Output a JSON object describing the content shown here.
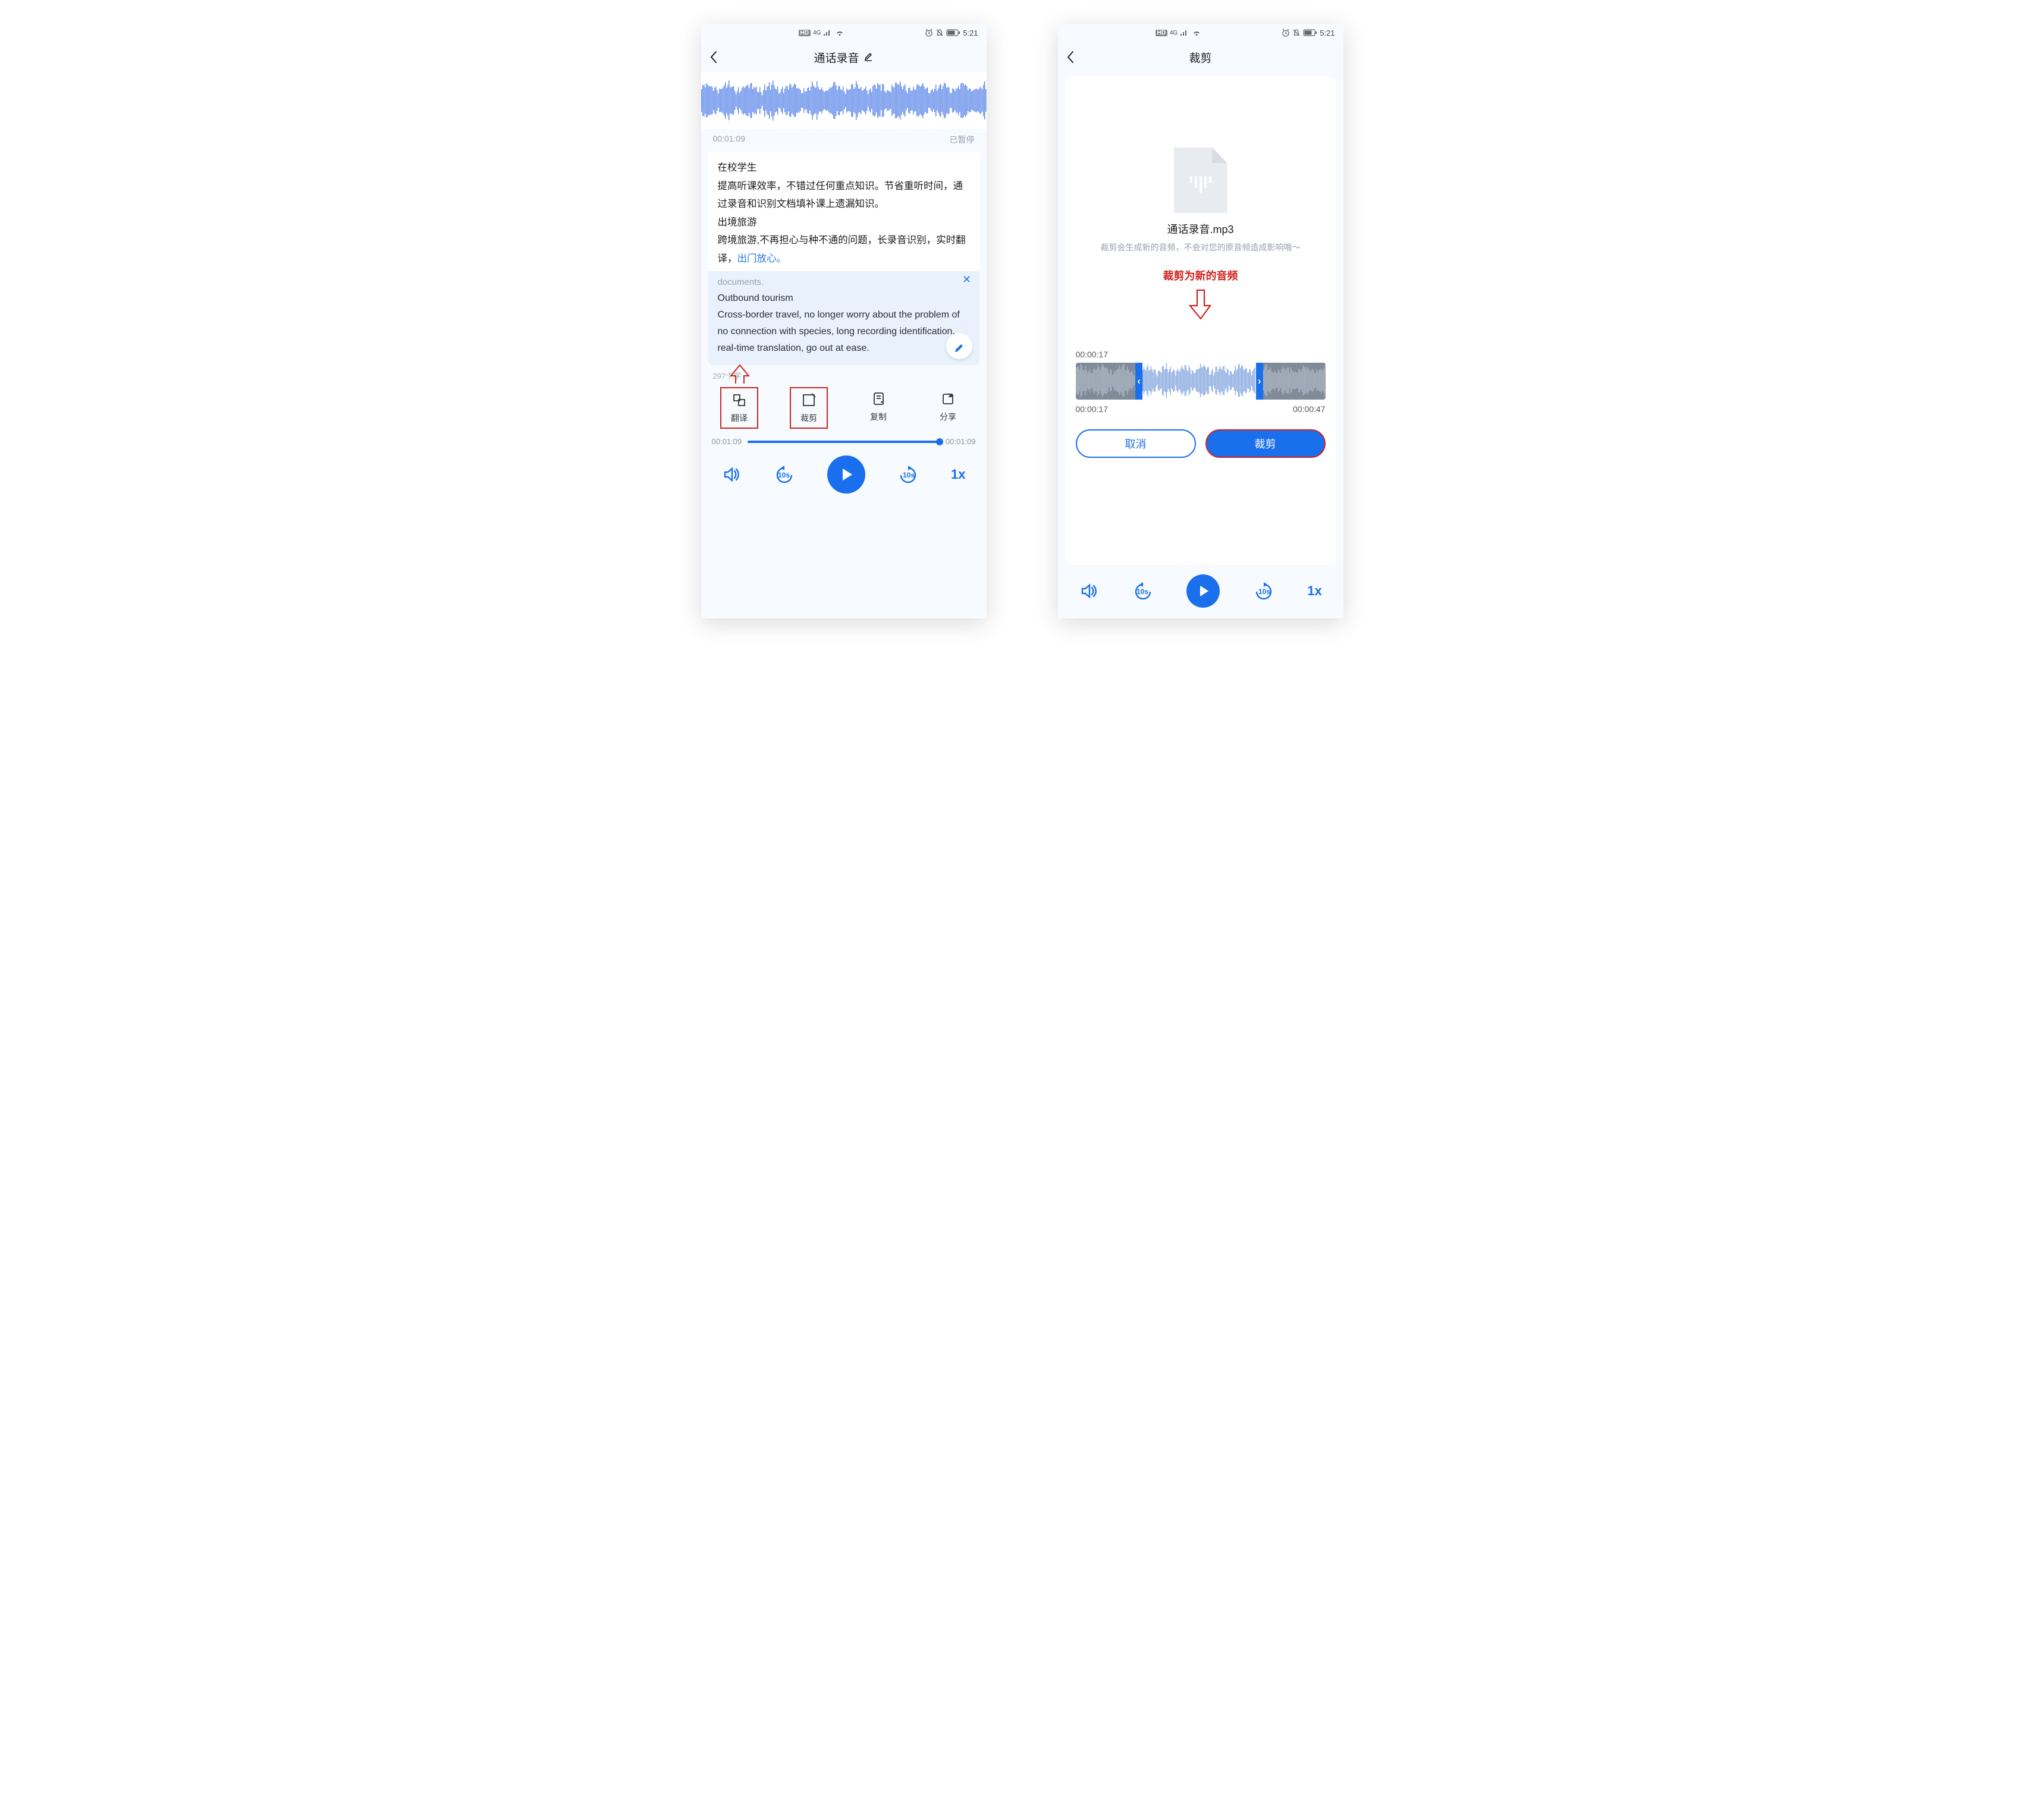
{
  "statusbar": {
    "hd": "HD",
    "net": "4G",
    "time": "5:21"
  },
  "screen1": {
    "title": "通话录音",
    "wave_time": "00:01:09",
    "wave_status": "已暂停",
    "body": {
      "line1": "在校学生",
      "line2": "提高听课效率，不错过任何重点知识。节省重听时间，通过录音和识别文档填补课上遗漏知识。",
      "line3": "出境旅游",
      "line4a": "跨境旅游,不再担心与种不通的问题，长录音识别，实时翻译，",
      "line4b": "出门放心。"
    },
    "trans": {
      "faded": "documents.",
      "t1": "Outbound tourism",
      "t2": "Cross-border travel, no longer worry about the problem of no connection with species, long recording identification, real-time translation, go out at ease."
    },
    "word_count": "297个字",
    "actions": {
      "translate": "翻译",
      "crop": "裁剪",
      "copy": "复制",
      "share": "分享"
    },
    "progress": {
      "left": "00:01:09",
      "right": "00:01:09",
      "percent": 100
    },
    "speed": "1x"
  },
  "screen2": {
    "title": "裁剪",
    "filename": "通话录音.mp3",
    "subtitle": "裁剪会生成新的音频，不会对您的原音频造成影响哦～",
    "red_caption": "裁剪为新的音频",
    "trim": {
      "top_time": "00:00:17",
      "start_time": "00:00:17",
      "end_time": "00:00:47",
      "sel_start_pct": 24,
      "sel_end_pct": 75
    },
    "buttons": {
      "cancel": "取消",
      "crop": "裁剪"
    },
    "speed": "1x"
  }
}
